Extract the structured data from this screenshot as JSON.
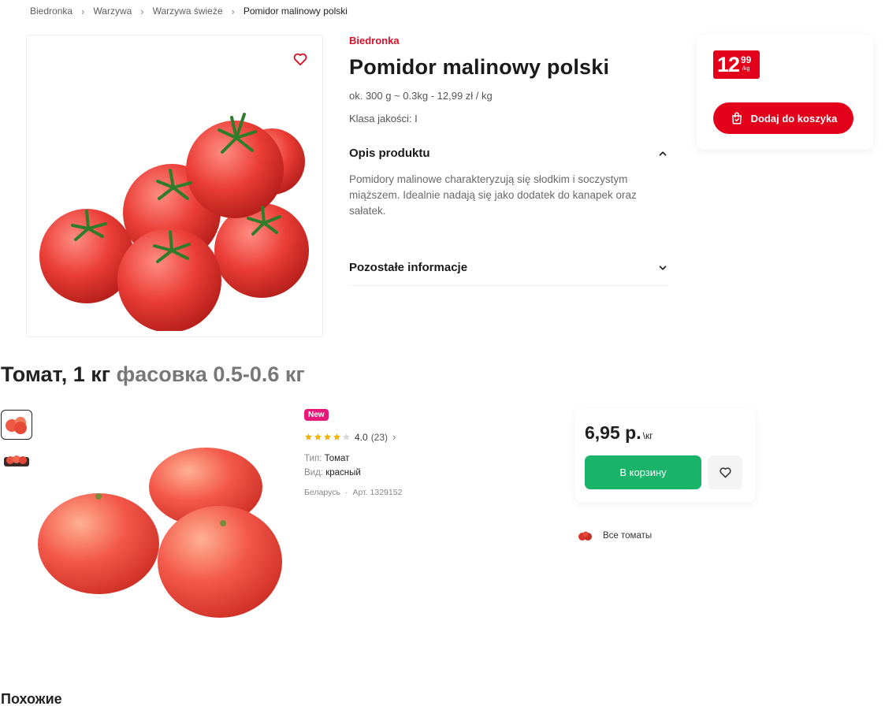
{
  "breadcrumb": {
    "items": [
      "Biedronka",
      "Warzywa",
      "Warzywa świeże"
    ],
    "current": "Pomidor malinowy polski",
    "separator": "›"
  },
  "product1": {
    "brand": "Biedronka",
    "title": "Pomidor malinowy polski",
    "weight_info": "ok. 300 g ~ 0.3kg - 12,99 zł / kg",
    "quality_class": "Klasa jakości: I",
    "description": {
      "heading": "Opis produktu",
      "text": "Pomidory malinowe charakteryzują się słodkim i soczystym miąższem. Idealnie nadają się jako dodatek do kanapek oraz sałatek."
    },
    "other_info": {
      "heading": "Pozostałe informacje"
    },
    "price": {
      "whole": "12",
      "decimal": "99",
      "unit": "/kg"
    },
    "add_to_cart_label": "Dodaj do koszyka",
    "icons": {
      "favorite": "heart-icon",
      "cart": "shopping-bag-icon",
      "collapse": "chevron-up-icon",
      "expand": "chevron-down-icon"
    },
    "brand_color": "#e2001a"
  },
  "product2": {
    "title_main": "Томат, 1 кг",
    "title_sub": "фасовка 0.5-0.6 кг",
    "badge": "New",
    "rating": {
      "value": "4.0",
      "count": "(23)",
      "stars": 4,
      "max": 5
    },
    "attributes": [
      {
        "key": "Тип:",
        "value": "Томат"
      },
      {
        "key": "Вид:",
        "value": "красный"
      }
    ],
    "origin": "Беларусь",
    "article": "Арт. 1329152",
    "price": "6,95 р.",
    "price_unit": "\\кг",
    "to_cart_label": "В корзину",
    "all_link": "Все томаты",
    "accent_color": "#1ab36a",
    "badge_color": "#e6197a"
  },
  "similar_heading": "Похожие"
}
